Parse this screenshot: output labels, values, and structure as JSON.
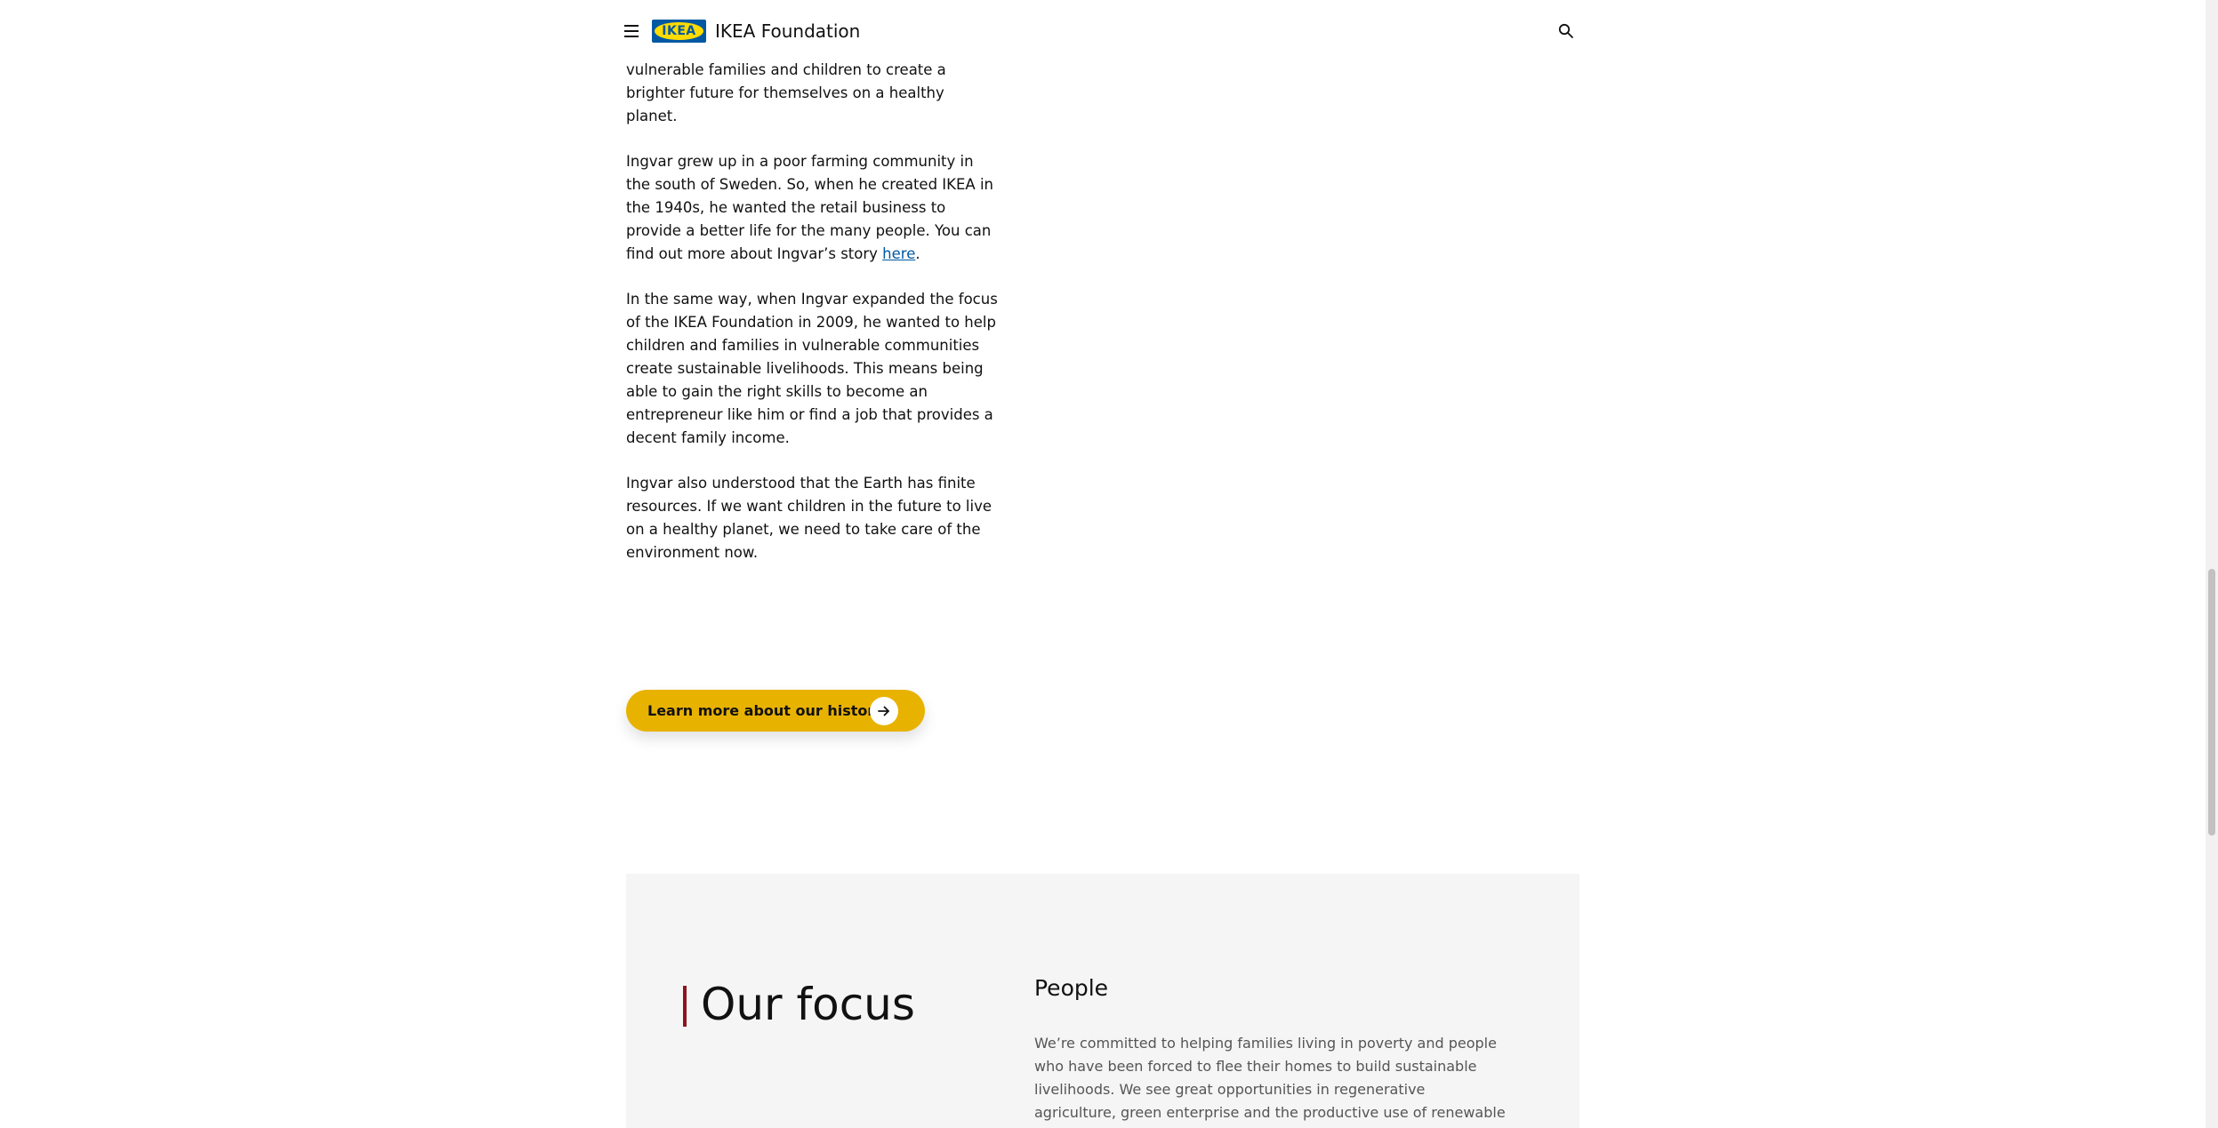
{
  "header": {
    "logo_text": "IKEA",
    "brand": "IKEA Foundation"
  },
  "article": {
    "p1": "very clear. He wanted to create opportunities for vulnerable families and children to create a brighter future for themselves on a healthy planet.",
    "p2_before_link": "Ingvar grew up in a poor farming community in the south of Sweden. So, when he created IKEA in the 1940s, he wanted the retail business to provide a better life for the many people. You can find out more about Ingvar’s story ",
    "p2_link": "here",
    "p2_after_link": ".",
    "p3": "In the same way, when Ingvar expanded the focus of the IKEA Foundation in 2009, he wanted to help children and families in vulnerable communities create sustainable livelihoods. This means being able to gain the right skills to become an entrepreneur like him or find a job that provides a decent family income.",
    "p4": "Ingvar also understood that the Earth has finite resources. If we want children in the future to live on a healthy planet, we need to take care of the environment now."
  },
  "cta": {
    "label": "Learn more about our history"
  },
  "focus": {
    "title": "Our focus",
    "subtitle": "People",
    "body": "We’re committed to helping families living in poverty and people who have been forced to flee their homes to build sustainable livelihoods. We see great opportunities in regenerative agriculture, green enterprise and the productive use of renewable energy."
  },
  "colors": {
    "accent_yellow": "#e8b200",
    "link_blue": "#0058a3",
    "focus_bar": "#8b1420",
    "section_bg": "#f5f5f5"
  },
  "icons": {
    "menu": "hamburger-menu-icon",
    "search": "search-icon",
    "cta": "arrow-right-icon"
  }
}
